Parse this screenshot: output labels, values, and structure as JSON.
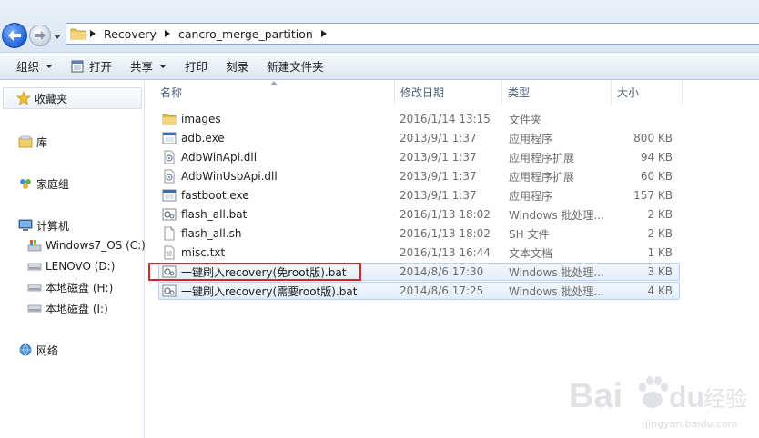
{
  "breadcrumb": [
    "Recovery",
    "cancro_merge_partition"
  ],
  "toolbar": {
    "organize": "组织",
    "open": "打开",
    "share": "共享",
    "print": "打印",
    "burn": "刻录",
    "new_folder": "新建文件夹"
  },
  "nav": {
    "favorites": "收藏夹",
    "libraries": "库",
    "homegroup": "家庭组",
    "computer": "计算机",
    "drives": [
      "Windows7_OS (C:)",
      "LENOVO (D:)",
      "本地磁盘 (H:)",
      "本地磁盘 (I:)"
    ],
    "network": "网络"
  },
  "columns": {
    "name": "名称",
    "modified": "修改日期",
    "type": "类型",
    "size": "大小"
  },
  "files": [
    {
      "name": "images",
      "date": "2016/1/14 13:15",
      "type": "文件夹",
      "size": "",
      "icon": "folder-icon"
    },
    {
      "name": "adb.exe",
      "date": "2013/9/1 1:37",
      "type": "应用程序",
      "size": "800 KB",
      "icon": "exe-icon"
    },
    {
      "name": "AdbWinApi.dll",
      "date": "2013/9/1 1:37",
      "type": "应用程序扩展",
      "size": "94 KB",
      "icon": "dll-icon"
    },
    {
      "name": "AdbWinUsbApi.dll",
      "date": "2013/9/1 1:37",
      "type": "应用程序扩展",
      "size": "60 KB",
      "icon": "dll-icon"
    },
    {
      "name": "fastboot.exe",
      "date": "2013/9/1 1:37",
      "type": "应用程序",
      "size": "157 KB",
      "icon": "exe-icon"
    },
    {
      "name": "flash_all.bat",
      "date": "2016/1/13 18:02",
      "type": "Windows 批处理...",
      "size": "2 KB",
      "icon": "bat-icon"
    },
    {
      "name": "flash_all.sh",
      "date": "2016/1/13 18:02",
      "type": "SH 文件",
      "size": "2 KB",
      "icon": "file-icon"
    },
    {
      "name": "misc.txt",
      "date": "2016/1/13 16:44",
      "type": "文本文档",
      "size": "1 KB",
      "icon": "txt-icon"
    },
    {
      "name": "一键刷入recovery(免root版).bat",
      "date": "2014/8/6 17:30",
      "type": "Windows 批处理...",
      "size": "3 KB",
      "icon": "bat-icon"
    },
    {
      "name": "一键刷入recovery(需要root版).bat",
      "date": "2014/8/6 17:25",
      "type": "Windows 批处理...",
      "size": "4 KB",
      "icon": "bat-icon"
    }
  ],
  "watermark": {
    "brand": "Bai",
    "brand2": "du",
    "cn": "经验",
    "url": "jingyan.baidu.com"
  }
}
